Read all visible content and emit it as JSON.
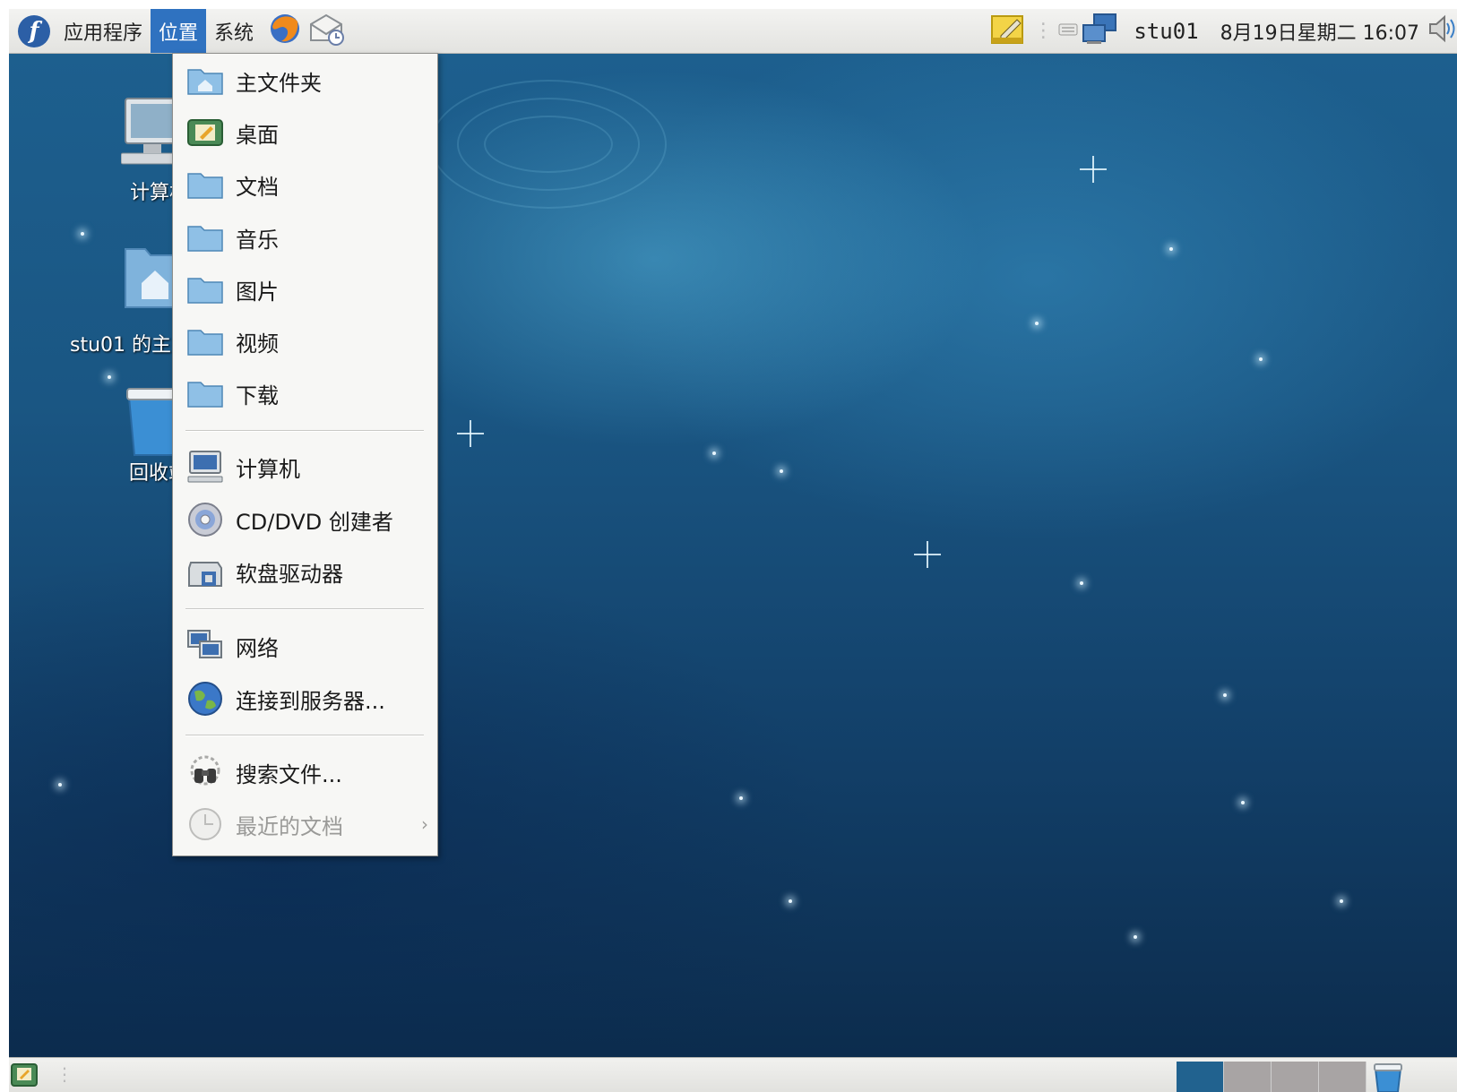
{
  "top_panel": {
    "menus": [
      "应用程序",
      "位置",
      "系统"
    ],
    "active_menu": "位置",
    "user": "stu01",
    "clock": "8月19日星期二 16:07",
    "icons": [
      "fedora-logo-icon",
      "firefox-icon",
      "mail-icon",
      "notes-icon",
      "keyboard-icon",
      "network-icon",
      "volume-icon"
    ]
  },
  "places_menu": {
    "items": [
      {
        "label": "主文件夹",
        "icon": "home-folder-icon"
      },
      {
        "label": "桌面",
        "icon": "desktop-folder-icon"
      },
      {
        "label": "文档",
        "icon": "folder-icon"
      },
      {
        "label": "音乐",
        "icon": "folder-icon"
      },
      {
        "label": "图片",
        "icon": "folder-icon"
      },
      {
        "label": "视频",
        "icon": "folder-icon"
      },
      {
        "label": "下载",
        "icon": "folder-icon"
      },
      {
        "label": "计算机",
        "icon": "computer-icon"
      },
      {
        "label": "CD/DVD 创建者",
        "icon": "cd-icon"
      },
      {
        "label": "软盘驱动器",
        "icon": "floppy-icon"
      },
      {
        "label": "网络",
        "icon": "network-icon"
      },
      {
        "label": "连接到服务器...",
        "icon": "globe-icon"
      },
      {
        "label": "搜索文件...",
        "icon": "search-binoculars-icon"
      },
      {
        "label": "最近的文档",
        "icon": "recent-clock-icon",
        "disabled": true,
        "submenu": true
      }
    ]
  },
  "desktop": {
    "icons": [
      {
        "label": "计算机",
        "icon": "computer-icon"
      },
      {
        "label": "stu01 的主文件夹",
        "icon": "home-folder-icon"
      },
      {
        "label": "回收站",
        "icon": "trash-icon"
      }
    ]
  },
  "bottom_panel": {
    "workspaces": 4,
    "active_workspace": 1,
    "icons": [
      "show-desktop-icon",
      "trash-applet-icon"
    ]
  },
  "colors": {
    "menu_highlight": "#2f72c0",
    "folder_blue": "#5fa8dd",
    "workspace_active": "#21628f"
  }
}
